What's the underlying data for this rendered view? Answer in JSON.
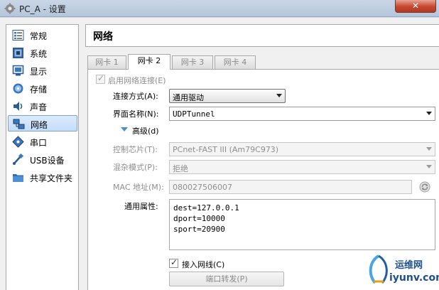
{
  "window": {
    "title": "PC_A - 设置",
    "close_glyph": "✕"
  },
  "sidebar": {
    "items": [
      {
        "label": "常规",
        "icon": "general-icon"
      },
      {
        "label": "系统",
        "icon": "system-icon"
      },
      {
        "label": "显示",
        "icon": "display-icon"
      },
      {
        "label": "存储",
        "icon": "storage-icon"
      },
      {
        "label": "声音",
        "icon": "audio-icon"
      },
      {
        "label": "网络",
        "icon": "network-icon",
        "selected": true
      },
      {
        "label": "串口",
        "icon": "serial-port-icon"
      },
      {
        "label": "USB设备",
        "icon": "usb-icon"
      },
      {
        "label": "共享文件夹",
        "icon": "shared-folder-icon"
      }
    ]
  },
  "main": {
    "title": "网络",
    "tabs": [
      {
        "label": "网卡 1"
      },
      {
        "label": "网卡 2",
        "active": true
      },
      {
        "label": "网卡 3"
      },
      {
        "label": "网卡 4"
      }
    ],
    "enable_adapter": {
      "label": "启用网络连接(E)",
      "checked": true
    },
    "attached_to": {
      "label": "连接方式(A):",
      "value": "通用驱动"
    },
    "name": {
      "label": "界面名称(N):",
      "value": "UDPTunnel"
    },
    "advanced": {
      "label": "高级(d)"
    },
    "adapter_type": {
      "label": "控制芯片(T):",
      "value": "PCnet-FAST III (Am79C973)"
    },
    "promiscuous": {
      "label": "混杂模式(P):",
      "value": "拒绝"
    },
    "mac": {
      "label": "MAC 地址(M):",
      "value": "080027506007"
    },
    "generic_properties": {
      "label": "通用属性:",
      "lines": [
        "dest=127.0.0.1",
        "dport=10000",
        "sport=20900"
      ]
    },
    "cable_connected": {
      "label": "接入网线(C)",
      "checked": true
    },
    "port_forwarding": {
      "label": "端口转发(P)"
    }
  },
  "watermark": {
    "text_cn": "运维网",
    "text_en": "iyunv.com"
  },
  "colors": {
    "selection": "#c4ddfb",
    "accent": "#4b8fd1",
    "close": "#c7472f"
  }
}
